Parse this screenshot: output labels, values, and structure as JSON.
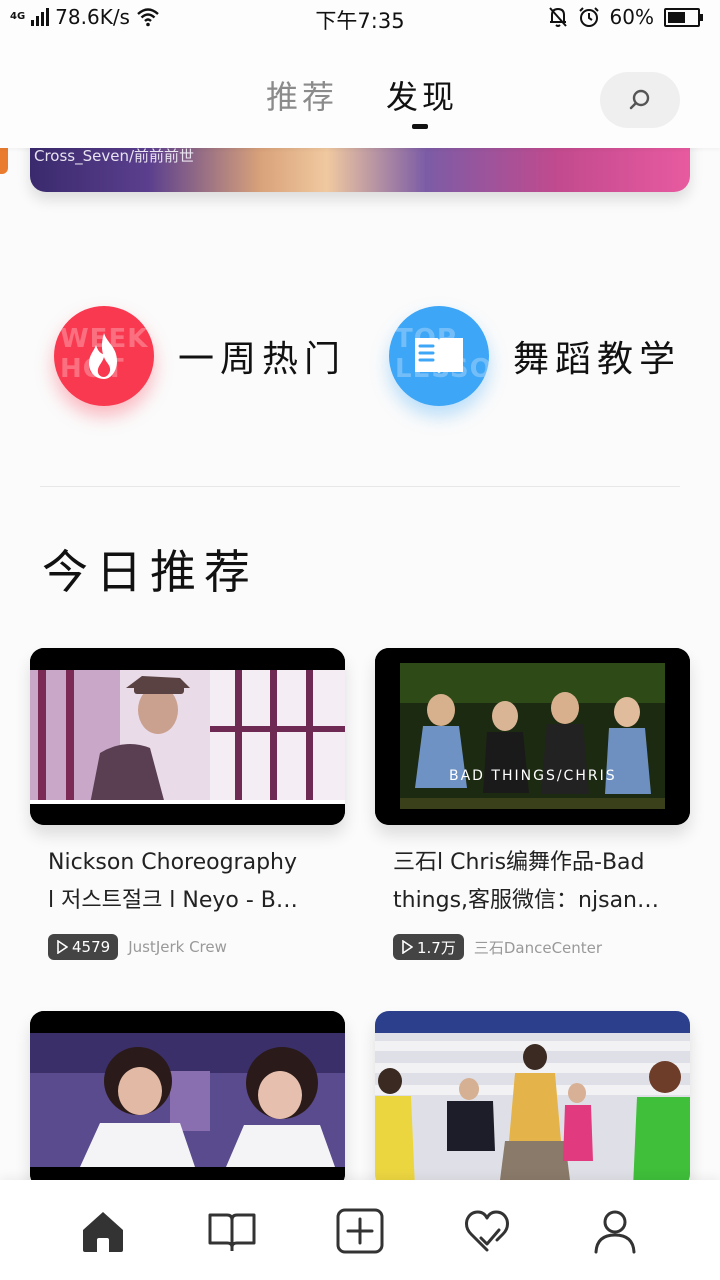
{
  "status_bar": {
    "network_type": "4G",
    "speed": "78.6K/s",
    "time": "下午7:35",
    "battery_percent": "60%",
    "battery_level": 0.6
  },
  "top_nav": {
    "tabs": [
      {
        "label": "推荐",
        "active": false
      },
      {
        "label": "发现",
        "active": true
      }
    ],
    "search_icon": "search-icon"
  },
  "banner": {
    "caption": "Cross_Seven/前前前世"
  },
  "quick_entries": [
    {
      "label": "一周热门",
      "icon": "flame-icon",
      "watermark": "WEEK HOT",
      "color": "#f9394f"
    },
    {
      "label": "舞蹈教学",
      "icon": "book-icon",
      "watermark": "TOP LESSON",
      "color": "#3da6f6"
    }
  ],
  "section": {
    "title": "今日推荐"
  },
  "videos": [
    {
      "title_line1": "Nickson Choreography",
      "title_line2": "l 저스트절크 l Neyo - B…",
      "plays": "4579",
      "uploader": "JustJerk Crew"
    },
    {
      "title_line1": "三石l Chris编舞作品-Bad",
      "title_line2": "things,客服微信：njsan…",
      "plays": "1.7万",
      "uploader": "三石DanceCenter",
      "overlay_text": "BAD THINGS/CHRIS"
    },
    {
      "title_line1": "",
      "title_line2": "",
      "plays": "",
      "uploader": ""
    },
    {
      "title_line1": "",
      "title_line2": "",
      "plays": "",
      "uploader": ""
    }
  ],
  "bottom_tabs": [
    {
      "icon": "home-icon",
      "active": true
    },
    {
      "icon": "book-open-icon",
      "active": false
    },
    {
      "icon": "add-square-icon",
      "active": false
    },
    {
      "icon": "heart-check-icon",
      "active": false
    },
    {
      "icon": "profile-icon",
      "active": false
    }
  ]
}
